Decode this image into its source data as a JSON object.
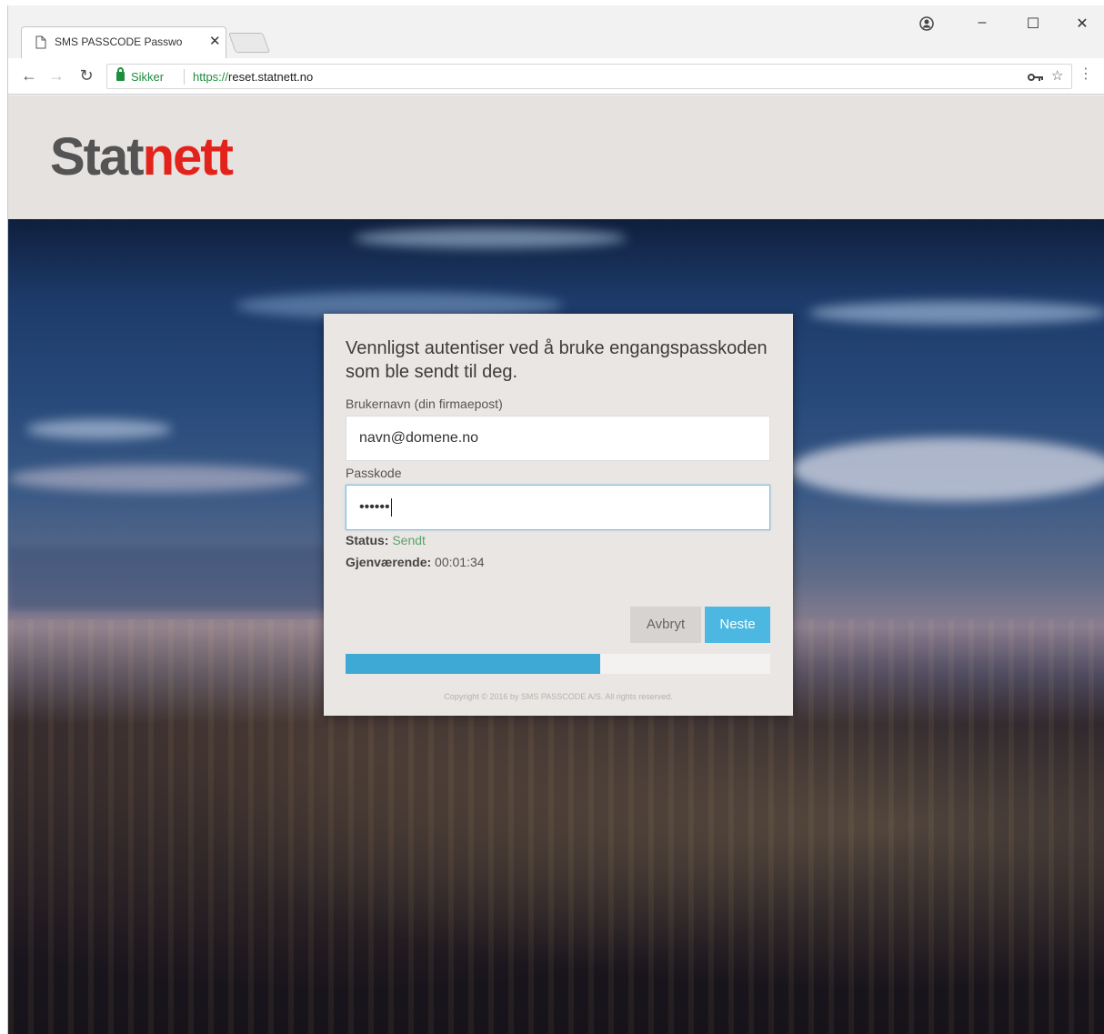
{
  "browser": {
    "tab_title": "SMS PASSCODE Passwo",
    "tab_close": "✕",
    "secure_label": "Sikker",
    "url_scheme": "https://",
    "url_host": "reset.statnett.no",
    "window_controls": {
      "minimize": "–",
      "maximize": "☐",
      "close": "✕"
    },
    "icons": [
      "page-icon",
      "profile-icon",
      "back-icon",
      "forward-icon",
      "reload-icon",
      "lock-icon",
      "key-icon",
      "star-icon",
      "menu-icon"
    ]
  },
  "header": {
    "logo_part1": "Stat",
    "logo_part2": "nett",
    "logo_colors": {
      "stat": "#545454",
      "nett": "#e3231b"
    }
  },
  "dialog": {
    "title": "Vennligst autentiser ved å bruke engangspasskoden som ble sendt til deg.",
    "username_label": "Brukernavn (din firmaepost)",
    "username_value": "navn@domene.no",
    "passcode_label": "Passkode",
    "passcode_value": "••••••",
    "status_label": "Status:",
    "status_value": "Sendt",
    "remaining_label": "Gjenværende:",
    "remaining_value": "00:01:34",
    "cancel_label": "Avbryt",
    "next_label": "Neste",
    "progress_percent": 60,
    "copyright": "Copyright © 2016 by SMS PASSCODE A/S. All rights reserved.",
    "colors": {
      "accent": "#4cb8e2",
      "progress": "#3fa9d6",
      "status_ok": "#5aa36b"
    }
  }
}
